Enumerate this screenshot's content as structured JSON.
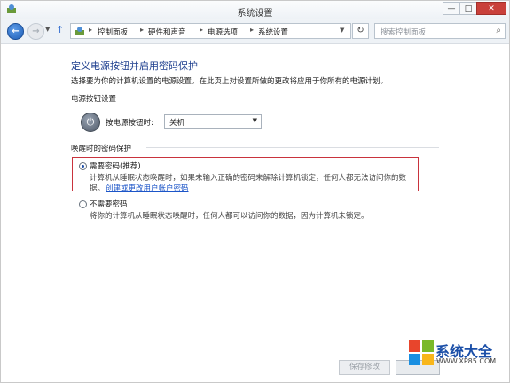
{
  "window": {
    "title": "系统设置"
  },
  "window_controls": {
    "minimize": "—",
    "maximize": "□",
    "close": "✕"
  },
  "nav": {
    "breadcrumbs": [
      "控制面板",
      "硬件和声音",
      "电源选项",
      "系统设置"
    ],
    "search_placeholder": "搜索控制面板"
  },
  "page": {
    "title": "定义电源按钮并启用密码保护",
    "description": "选择要为你的计算机设置的电源设置。在此页上对设置所做的更改将应用于你所有的电源计划。"
  },
  "power_section": {
    "title": "电源按钮设置",
    "label": "按电源按钮时:",
    "selected": "关机"
  },
  "wake_section": {
    "title": "唤醒时的密码保护",
    "options": [
      {
        "label": "需要密码(推荐)",
        "desc_line1": "计算机从睡眠状态唤醒时，如果未输入正确的密码来解除计算机锁定，任何人都无法访问你的数",
        "desc_line2": "据。",
        "link": "创建或更改用户帐户密码",
        "selected": true
      },
      {
        "label": "不需要密码",
        "desc_line1": "将你的计算机从睡眠状态唤醒时，任何人都可以访问你的数据，因为计算机未锁定。",
        "selected": false
      }
    ]
  },
  "buttons": {
    "save": "保存修改"
  },
  "watermark": {
    "text": "系统大全",
    "url": "WWW.XP85.COM"
  },
  "colors": {
    "title_blue": "#1e3f8f",
    "link_blue": "#1c55c8",
    "highlight_red": "#c9333d",
    "close_red": "#c9403a"
  }
}
